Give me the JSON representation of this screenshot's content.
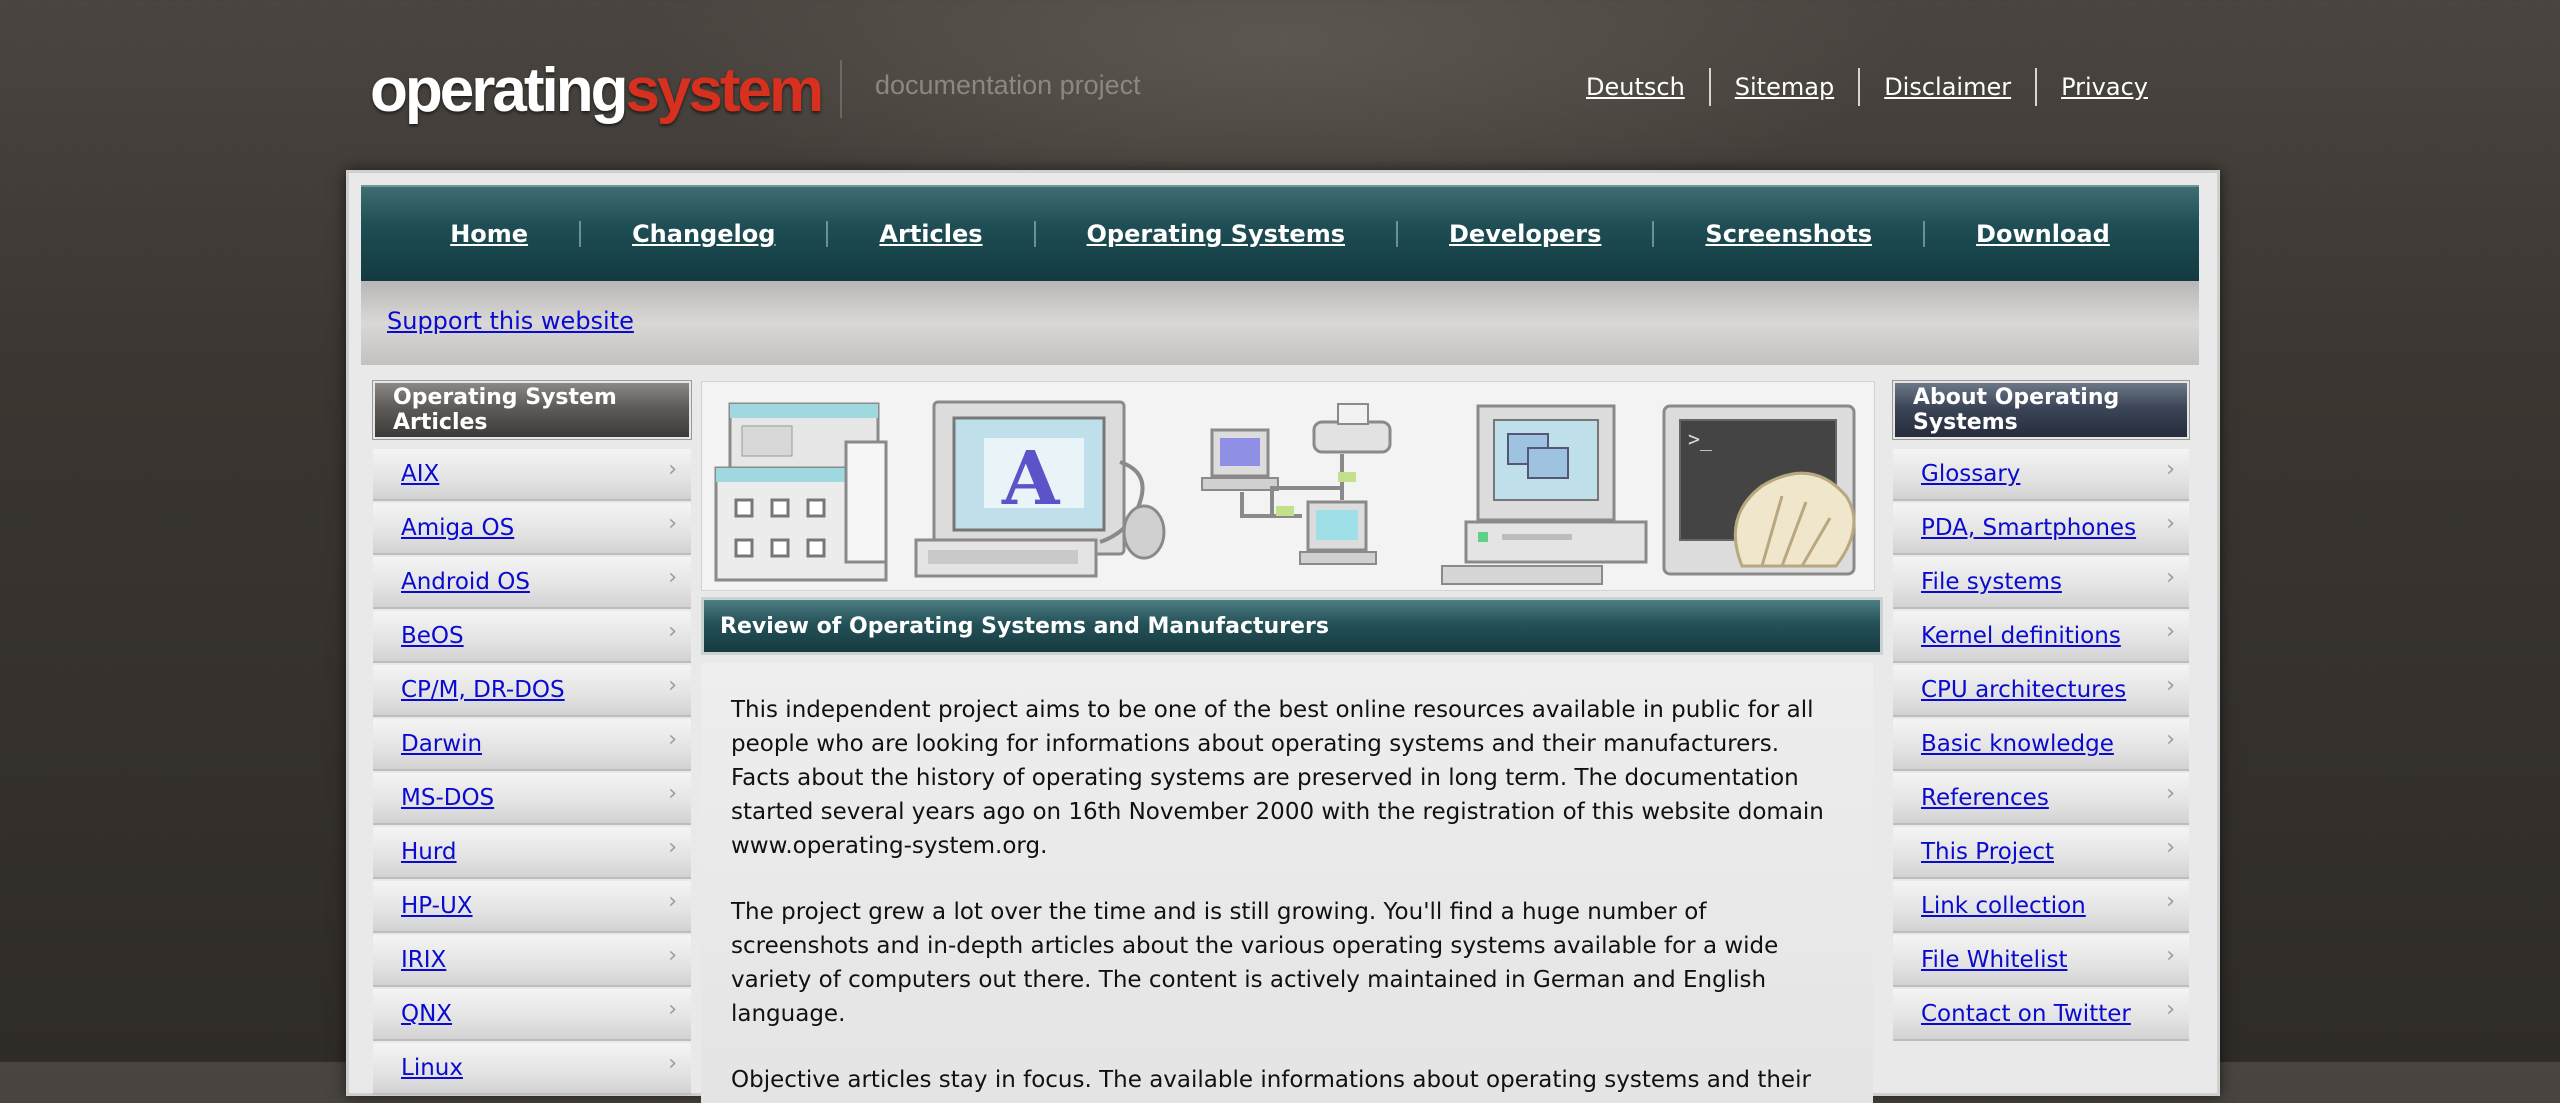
{
  "header": {
    "logo_part1": "operating",
    "logo_part2": "system",
    "logo_sub": "documentation project",
    "top_links": [
      "Deutsch",
      "Sitemap",
      "Disclaimer",
      "Privacy"
    ]
  },
  "nav": {
    "items": [
      "Home",
      "Changelog",
      "Articles",
      "Operating Systems",
      "Developers",
      "Screenshots",
      "Download"
    ]
  },
  "support": {
    "label": "Support this website"
  },
  "left": {
    "title": "Operating System Articles",
    "items": [
      "AIX",
      "Amiga OS",
      "Android OS",
      "BeOS",
      "CP/M, DR-DOS",
      "Darwin",
      "MS-DOS",
      "Hurd",
      "HP-UX",
      "IRIX",
      "QNX",
      "Linux"
    ]
  },
  "right": {
    "title": "About Operating Systems",
    "items": [
      "Glossary",
      "PDA, Smartphones",
      "File systems",
      "Kernel definitions",
      "CPU architectures",
      "Basic knowledge",
      "References",
      "This Project",
      "Link collection",
      "File Whitelist",
      "Contact on Twitter"
    ]
  },
  "main": {
    "title": "Review of Operating Systems and Manufacturers",
    "paragraphs": [
      "This independent project aims to be one of the best online resources available in public for all people who are looking for informations about operating systems and their manufacturers. Facts about the history of operating systems are preserved in long term. The documentation started several years ago on 16th November 2000 with the registration of this website domain www.operating-system.org.",
      "The project grew a lot over the time and is still growing. You'll find a huge number of screenshots and in-depth articles about the various operating systems available for a wide variety of computers out there. The content is actively maintained in German and English language.",
      "Objective articles stay in focus. The available informations about operating systems and their"
    ]
  },
  "colors": {
    "nav_teal": "#1f4e55",
    "link_blue": "#0a0ad0",
    "logo_red": "#d7301f"
  },
  "icons": [
    "windows-icon",
    "paint-computer-icon",
    "network-icon",
    "desktop-computer-icon",
    "terminal-shell-icon",
    "chevron-right-icon"
  ]
}
